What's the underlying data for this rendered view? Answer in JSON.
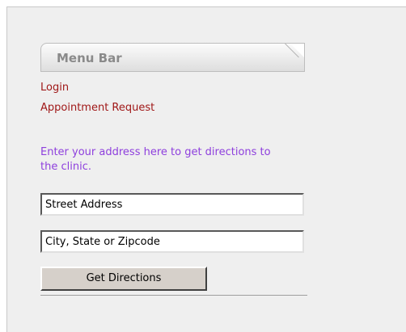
{
  "menu": {
    "title": "Menu Bar",
    "links": [
      {
        "label": "Login"
      },
      {
        "label": "Appointment Request"
      }
    ]
  },
  "directions": {
    "intro": "Enter your address here to get directions to the clinic.",
    "street_value": "Street Address",
    "city_value": "City, State or Zipcode",
    "button_label": "Get Directions"
  },
  "colors": {
    "link": "#a01818",
    "intro_text": "#8e3fdd",
    "panel_bg": "#efefef",
    "button_bg": "#d6d0ca"
  }
}
